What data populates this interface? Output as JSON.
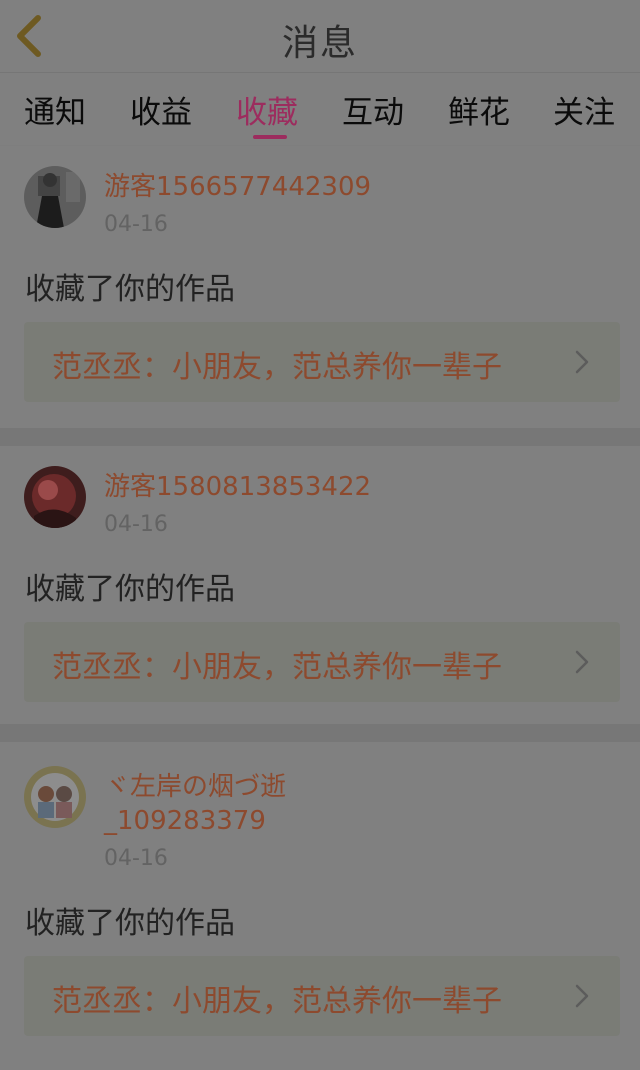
{
  "header": {
    "title": "消息"
  },
  "tabs": [
    {
      "label": "通知"
    },
    {
      "label": "收益"
    },
    {
      "label": "收藏",
      "active": true
    },
    {
      "label": "互动"
    },
    {
      "label": "鲜花"
    },
    {
      "label": "关注"
    }
  ],
  "messages": [
    {
      "username": "游客1566577442309",
      "date": "04-16",
      "action": "收藏了你的作品",
      "work_title": "范丞丞：小朋友，范总养你一辈子"
    },
    {
      "username": "游客1580813853422",
      "date": "04-16",
      "action": "收藏了你的作品",
      "work_title": "范丞丞：小朋友，范总养你一辈子"
    },
    {
      "username": "ヾ左岸の烟づ逝_109283379",
      "date": "04-16",
      "action": "收藏了你的作品",
      "work_title": "范丞丞：小朋友，范总养你一辈子"
    }
  ],
  "colors": {
    "accent": "#9c2c5e",
    "username": "#8d4a2e",
    "overlay": "#808080"
  },
  "icons": {
    "back": "chevron-left-icon",
    "item_arrow": "chevron-right-icon"
  }
}
